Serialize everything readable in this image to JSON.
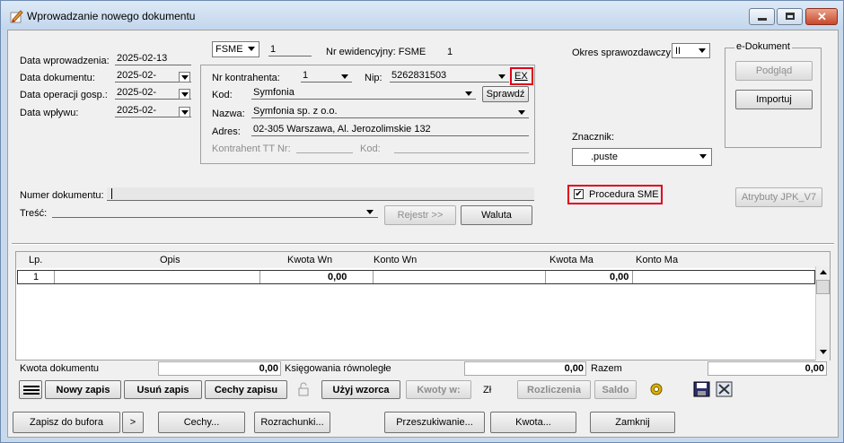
{
  "window": {
    "title": "Wprowadzanie nowego dokumentu"
  },
  "dates": {
    "data_wprowadzenia_label": "Data wprowadzenia:",
    "data_wprowadzenia": "2025-02-13",
    "data_dokumentu_label": "Data dokumentu:",
    "data_dokumentu": "2025-02-",
    "data_operacji_label": "Data operacji gosp.:",
    "data_operacji": "2025-02-",
    "data_wplywu_label": "Data wpływu:",
    "data_wplywu": "2025-02-"
  },
  "doc_type": {
    "value": "FSME",
    "number": "1",
    "nr_ewid_label": "Nr ewidencyjny: FSME",
    "nr_ewid_value": "1"
  },
  "contractor": {
    "nr_label": "Nr kontrahenta:",
    "nr_value": "1",
    "nip_label": "Nip:",
    "nip_value": "5262831503",
    "ex_label": "EX",
    "kod_label": "Kod:",
    "kod_value": "Symfonia",
    "sprawdz_label": "Sprawdź",
    "nazwa_label": "Nazwa:",
    "nazwa_value": "Symfonia sp. z o.o.",
    "adres_label": "Adres:",
    "adres_value": "02-305 Warszawa, Al. Jerozolimskie 132",
    "tt_label": "Kontrahent TT Nr:",
    "kod2_label": "Kod:"
  },
  "okres": {
    "label": "Okres sprawozdawczy:",
    "value": "II"
  },
  "edokument": {
    "legend": "e-Dokument",
    "podglad": "Podgląd",
    "importuj": "Importuj"
  },
  "znacznik": {
    "label": "Znacznik:",
    "value": ".puste"
  },
  "procedura": {
    "label": "Procedura SME",
    "checked": "✔"
  },
  "atrybuty_label": "Atrybuty JPK_V7",
  "numer": {
    "label": "Numer dokumentu:",
    "value": ""
  },
  "tresc": {
    "label": "Treść:",
    "rejestr": "Rejestr >>",
    "waluta": "Waluta"
  },
  "table": {
    "headers": [
      "Lp.",
      "Opis",
      "Kwota  Wn",
      "Konto  Wn",
      "Kwota Ma",
      "Konto Ma"
    ],
    "rows": [
      {
        "lp": "1",
        "opis": "",
        "kwota_wn": "0,00",
        "konto_wn": "",
        "kwota_ma": "0,00",
        "konto_ma": ""
      }
    ]
  },
  "totals": {
    "kwota_label": "Kwota dokumentu",
    "kwota": "0,00",
    "ksieg_label": "Księgowania równoległe",
    "ksieg": "0,00",
    "razem_label": "Razem",
    "razem": "0,00"
  },
  "toolbar": {
    "nowy": "Nowy zapis",
    "usun": "Usuń zapis",
    "cechy_zapisu": "Cechy zapisu",
    "uzyj": "Użyj wzorca",
    "kwoty": "Kwoty w:",
    "zl": "Zł",
    "rozliczenia": "Rozliczenia",
    "saldo": "Saldo"
  },
  "bottom": {
    "zapisz": "Zapisz do bufora",
    "more": ">",
    "cechy": "Cechy...",
    "rozrachunki": "Rozrachunki...",
    "przeszukiwanie": "Przeszukiwanie...",
    "kwota": "Kwota...",
    "zamknij": "Zamknij"
  }
}
